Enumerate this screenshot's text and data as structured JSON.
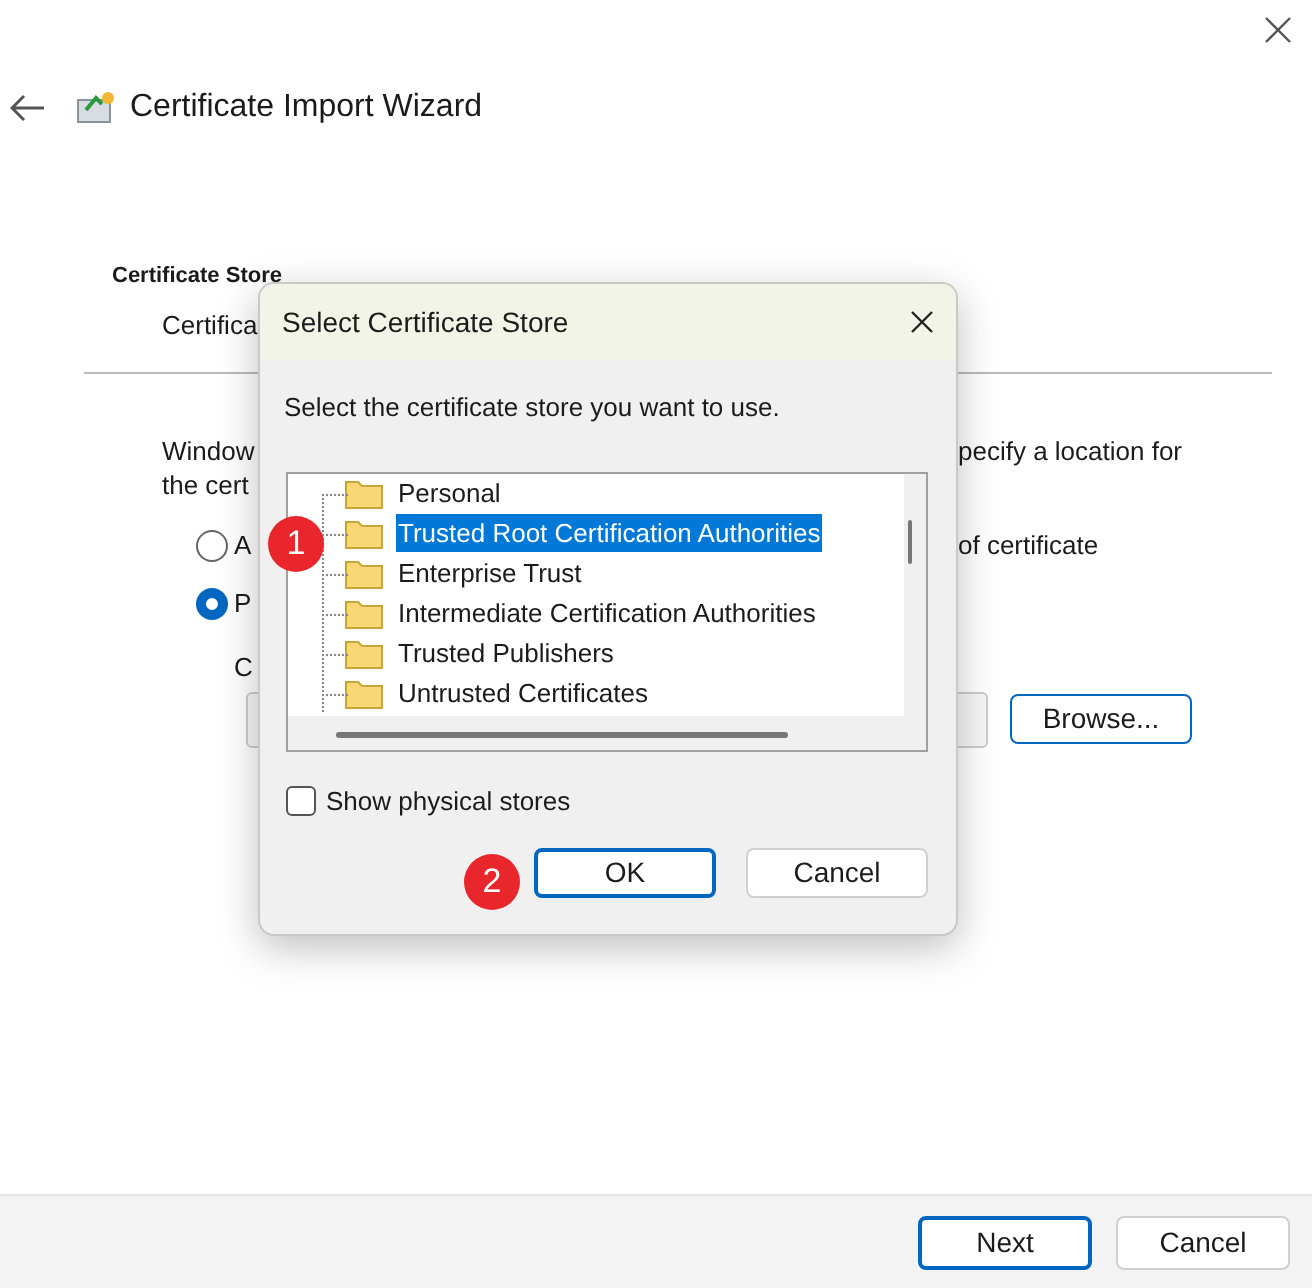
{
  "window": {
    "title": "Certificate Import Wizard"
  },
  "page": {
    "heading": "Certificate Store",
    "subheading_visible": "Certifica",
    "description_left": [
      "Window",
      "the cert"
    ],
    "description_right": "pecify a location for",
    "radios": [
      {
        "label_left": "A",
        "label_right": "of certificate",
        "selected": false
      },
      {
        "label_left": "P",
        "selected": true
      }
    ],
    "store_label": "C",
    "browse_button": "Browse..."
  },
  "dialog": {
    "title": "Select Certificate Store",
    "prompt": "Select the certificate store you want to use.",
    "stores": [
      {
        "label": "Personal",
        "selected": false
      },
      {
        "label": "Trusted Root Certification Authorities",
        "selected": true
      },
      {
        "label": "Enterprise Trust",
        "selected": false
      },
      {
        "label": "Intermediate Certification Authorities",
        "selected": false
      },
      {
        "label": "Trusted Publishers",
        "selected": false
      },
      {
        "label": "Untrusted Certificates",
        "selected": false
      }
    ],
    "show_physical_stores": {
      "label": "Show physical stores",
      "checked": false
    },
    "buttons": [
      {
        "label": "OK",
        "kind": "default"
      },
      {
        "label": "Cancel",
        "kind": "normal"
      }
    ]
  },
  "step_badges": [
    "1",
    "2"
  ],
  "footer": {
    "buttons": [
      {
        "label": "Next",
        "kind": "default"
      },
      {
        "label": "Cancel",
        "kind": "normal"
      }
    ]
  }
}
